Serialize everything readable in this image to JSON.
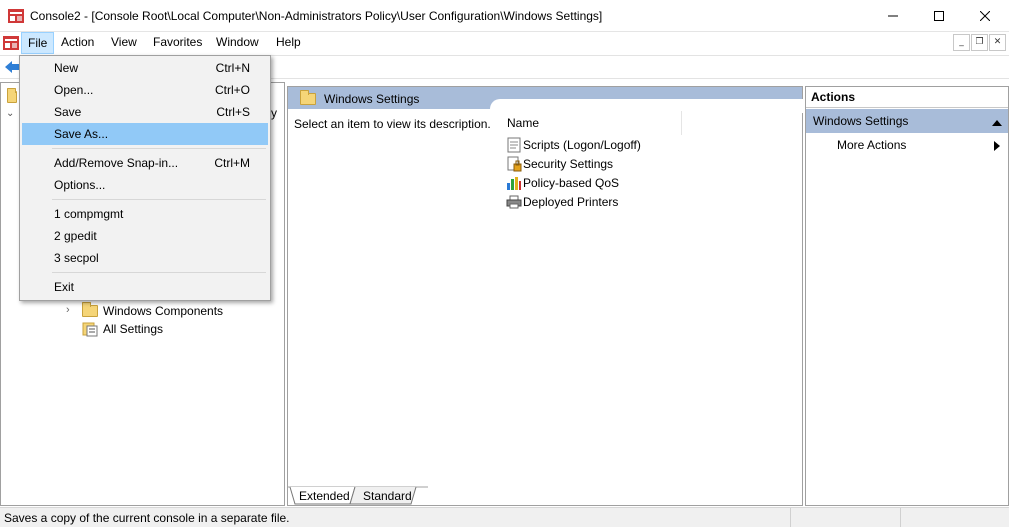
{
  "window": {
    "title": "Console2 - [Console Root\\Local Computer\\Non-Administrators Policy\\User Configuration\\Windows Settings]",
    "minimize_glyph": "—",
    "maximize_glyph": "☐",
    "close_glyph": "✕"
  },
  "menubar": {
    "file": "File",
    "action": "Action",
    "view": "View",
    "favorites": "Favorites",
    "window": "Window",
    "help": "Help"
  },
  "mdi_controls": [
    "_",
    "❐",
    "✕"
  ],
  "file_menu": {
    "items": [
      {
        "label": "New",
        "shortcut": "Ctrl+N"
      },
      {
        "label": "Open...",
        "shortcut": "Ctrl+O"
      },
      {
        "label": "Save",
        "shortcut": "Ctrl+S"
      },
      {
        "label": "Save As...",
        "shortcut": ""
      },
      {
        "label": "Add/Remove Snap-in...",
        "shortcut": "Ctrl+M"
      },
      {
        "label": "Options...",
        "shortcut": ""
      },
      {
        "label": "1 compmgmt",
        "shortcut": ""
      },
      {
        "label": "2 gpedit",
        "shortcut": ""
      },
      {
        "label": "3 secpol",
        "shortcut": ""
      },
      {
        "label": "Exit",
        "shortcut": ""
      }
    ]
  },
  "tree": {
    "partial_char": "y",
    "items": [
      {
        "label": "Windows Components"
      },
      {
        "label": "All Settings"
      }
    ]
  },
  "center": {
    "header": "Windows Settings",
    "description": "Select an item to view its description.",
    "column_name": "Name",
    "items": [
      {
        "label": "Scripts (Logon/Logoff)",
        "icon": "script-icon"
      },
      {
        "label": "Security Settings",
        "icon": "security-settings-icon"
      },
      {
        "label": "Policy-based QoS",
        "icon": "bar-chart-icon"
      },
      {
        "label": "Deployed Printers",
        "icon": "printer-icon"
      }
    ],
    "tabs": {
      "extended": "Extended",
      "standard": "Standard"
    }
  },
  "actions": {
    "title": "Actions",
    "section": "Windows Settings",
    "more": "More Actions"
  },
  "status": {
    "text": "Saves a copy of the current console in a separate file."
  },
  "colors": {
    "menu_highlight": "#91c9f7",
    "header_blue": "#a8bcd9",
    "actions_section": "#a8bcd9"
  }
}
